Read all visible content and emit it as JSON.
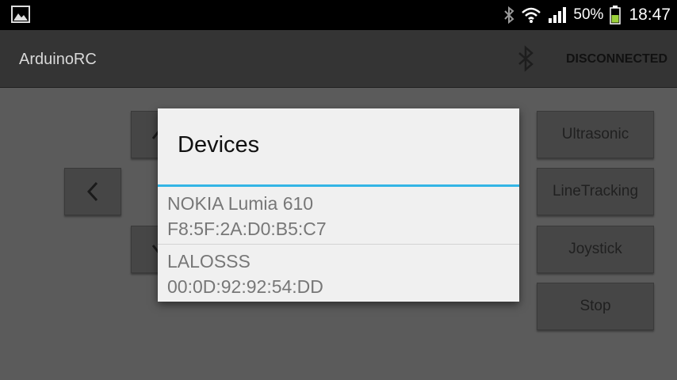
{
  "status_bar": {
    "battery": "50%",
    "time": "18:47",
    "icons": [
      "picture-icon",
      "bluetooth-icon",
      "wifi-icon",
      "signal-icon",
      "battery-icon"
    ]
  },
  "action_bar": {
    "title": "ArduinoRC",
    "connection_status": "DISCONNECTED",
    "icon": "bluetooth-icon"
  },
  "controls": {
    "dpad": [
      "up",
      "left",
      "down"
    ],
    "mode_buttons": [
      "Ultrasonic",
      "LineTracking",
      "Joystick",
      "Stop"
    ]
  },
  "dialog": {
    "title": "Devices",
    "accent_color": "#33b5e5",
    "devices": [
      {
        "name": "NOKIA Lumia 610",
        "address": "F8:5F:2A:D0:B5:C7"
      },
      {
        "name": "LALOSSS",
        "address": "00:0D:92:92:54:DD"
      }
    ]
  }
}
